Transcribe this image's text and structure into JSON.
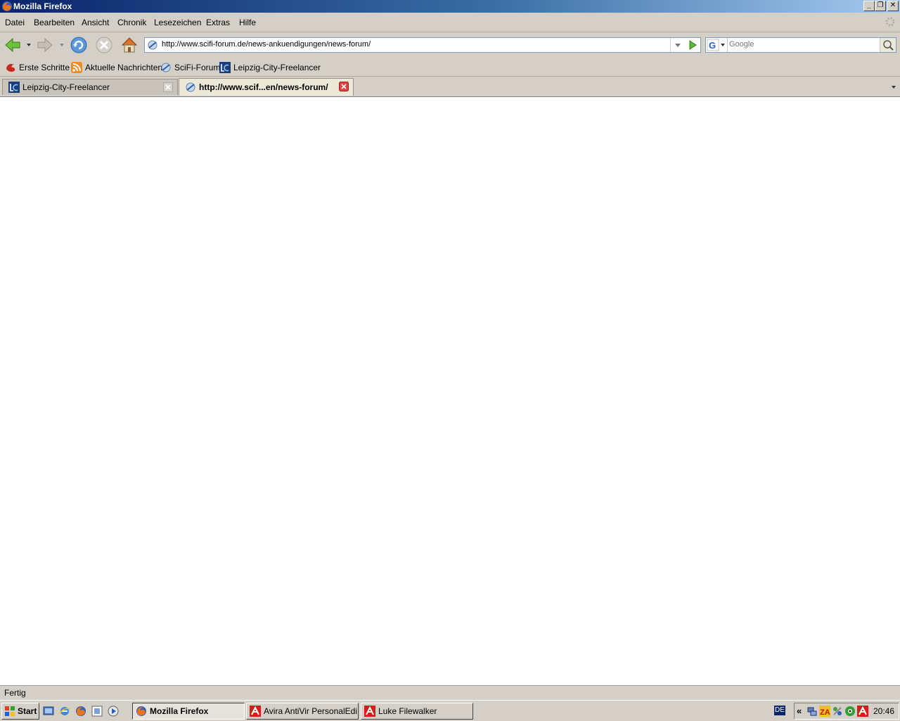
{
  "window": {
    "title": "Mozilla Firefox",
    "controls": {
      "minimize": "_",
      "maximize": "❐",
      "close": "✕"
    }
  },
  "menu": {
    "items": [
      {
        "label": "Datei"
      },
      {
        "label": "Bearbeiten"
      },
      {
        "label": "Ansicht"
      },
      {
        "label": "Chronik"
      },
      {
        "label": "Lesezeichen"
      },
      {
        "label": "Extras"
      },
      {
        "label": "Hilfe"
      }
    ]
  },
  "navigation": {
    "url": "http://www.scifi-forum.de/news-ankuendigungen/news-forum/",
    "search_placeholder": "Google",
    "icons": [
      "back-arrow-icon",
      "forward-arrow-icon",
      "reload-icon",
      "stop-icon",
      "home-icon"
    ]
  },
  "bookmarks": [
    {
      "label": "Erste Schritte",
      "icon": "firefox-red-icon"
    },
    {
      "label": "Aktuelle Nachrichten",
      "icon": "rss-feed-icon"
    },
    {
      "label": "SciFi-Forum",
      "icon": "page-icon"
    },
    {
      "label": "Leipzig-City-Freelancer",
      "icon": "lc-logo-icon"
    }
  ],
  "tabs": [
    {
      "label": "Leipzig-City-Freelancer",
      "active": false
    },
    {
      "label": "http://www.scif...en/news-forum/",
      "active": true
    }
  ],
  "status": {
    "text": "Fertig"
  },
  "taskbar": {
    "start_label": "Start",
    "tasks": [
      {
        "label": "Mozilla Firefox",
        "active": true
      },
      {
        "label": "Avira AntiVir PersonalEdi...",
        "active": false
      },
      {
        "label": "Luke Filewalker",
        "active": false
      }
    ],
    "language": "DE",
    "clock": "20:46",
    "tray_expand": "«"
  },
  "colors": {
    "titlebar_start": "#0a246a",
    "chrome": "#d4d0c8",
    "active_tab": "#ece9d8",
    "url_border": "#7f9db9"
  }
}
